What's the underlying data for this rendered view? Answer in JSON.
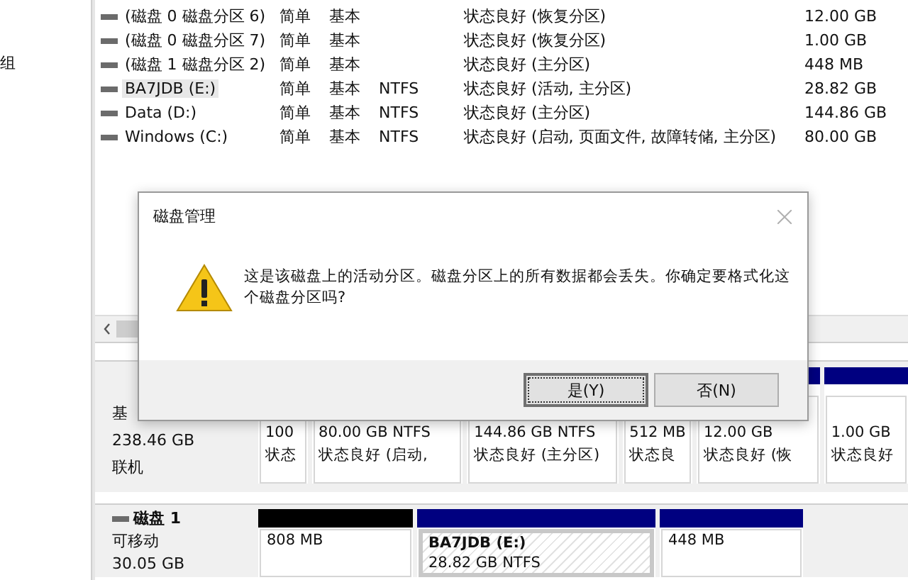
{
  "side_panel": {
    "label": "组"
  },
  "volumes": [
    {
      "name": "(磁盘 0 磁盘分区 6)",
      "layout": "简单",
      "type": "基本",
      "status": "状态良好 (恢复分区)",
      "capacity": "12.00 GB",
      "selected": false
    },
    {
      "name": "(磁盘 0 磁盘分区 7)",
      "layout": "简单",
      "type": "基本",
      "status": "状态良好 (恢复分区)",
      "capacity": "1.00 GB",
      "selected": false
    },
    {
      "name": "(磁盘 1 磁盘分区 2)",
      "layout": "简单",
      "type": "基本",
      "status": "状态良好 (主分区)",
      "capacity": "448 MB",
      "selected": false
    },
    {
      "name": "BA7JDB (E:)",
      "layout": "简单",
      "type": "基本",
      "file_system": "NTFS",
      "status": "状态良好 (活动, 主分区)",
      "capacity": "28.82 GB",
      "selected": true
    },
    {
      "name": "Data (D:)",
      "layout": "简单",
      "type": "基本",
      "file_system": "NTFS",
      "status": "状态良好 (主分区)",
      "capacity": "144.86 GB",
      "selected": false
    },
    {
      "name": "Windows (C:)",
      "layout": "简单",
      "type": "基本",
      "file_system": "NTFS",
      "status": "状态良好 (启动, 页面文件, 故障转储, 主分区)",
      "capacity": "80.00 GB",
      "selected": false
    }
  ],
  "disks": [
    {
      "type": "基",
      "size": "238.46 GB",
      "status": "联机",
      "partitions": [
        {
          "line1": "100",
          "line2": "状态",
          "selected": false
        },
        {
          "line1": "80.00 GB NTFS",
          "line2": "状态良好 (启动,",
          "selected": false
        },
        {
          "line1": "144.86 GB NTFS",
          "line2": "状态良好 (主分区)",
          "selected": false
        },
        {
          "line1": "512 MB",
          "line2": "状态良",
          "selected": false
        },
        {
          "line1": "12.00 GB",
          "line2": "状态良好 (恢",
          "color": "#000080",
          "selected": false
        },
        {
          "line1": "1.00 GB",
          "line2": "状态良好",
          "color": "#000080",
          "selected": false
        }
      ]
    },
    {
      "title": "磁盘 1",
      "type": "可移动",
      "size": "30.05 GB",
      "partitions": [
        {
          "line1": "808 MB",
          "color": "#000000",
          "selected": false
        },
        {
          "name": "BA7JDB  (E:)",
          "line1": "28.82 GB NTFS",
          "color": "#000080",
          "selected": true
        },
        {
          "line1": "448 MB",
          "color": "#000080",
          "selected": false
        }
      ]
    }
  ],
  "dialog": {
    "title": "磁盘管理",
    "message": "这是该磁盘上的活动分区。磁盘分区上的所有数据都会丢失。你确定要格式化这个磁盘分区吗?",
    "buttons": [
      {
        "label": "是(Y)",
        "default": true
      },
      {
        "label": "否(N)",
        "default": false
      }
    ]
  }
}
